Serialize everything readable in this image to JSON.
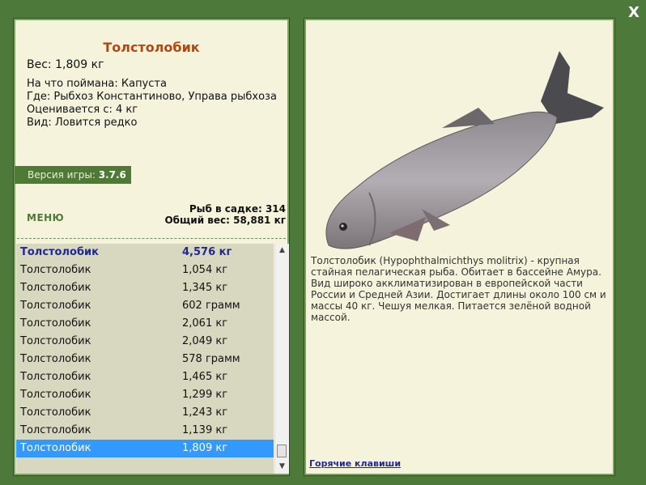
{
  "close_label": "X",
  "fish": {
    "name": "Толстолобик",
    "weight": "Вес: 1,809 кг",
    "caught_with": "На что поймана: Капуста",
    "location": "Где: Рыбхоз Константиново, Управа рыбхоза",
    "valued_from": "Оценивается с: 4 кг",
    "kind": "Вид: Ловится редко"
  },
  "version": {
    "label": "Версия игры:",
    "value": "3.7.6"
  },
  "menu_label": "МЕНЮ",
  "stats": {
    "fish_in_cage": "Рыб в садке: 314",
    "total_weight": "Общий вес: 58,881 кг"
  },
  "catch_list": [
    {
      "name": "Толстолобик",
      "weight": "4,576 кг"
    },
    {
      "name": "Толстолобик",
      "weight": "1,054 кг"
    },
    {
      "name": "Толстолобик",
      "weight": "1,345 кг"
    },
    {
      "name": "Толстолобик",
      "weight": "602 грамм"
    },
    {
      "name": "Толстолобик",
      "weight": "2,061 кг"
    },
    {
      "name": "Толстолобик",
      "weight": "2,049 кг"
    },
    {
      "name": "Толстолобик",
      "weight": "578 грамм"
    },
    {
      "name": "Толстолобик",
      "weight": "1,465 кг"
    },
    {
      "name": "Толстолобик",
      "weight": "1,299 кг"
    },
    {
      "name": "Толстолобик",
      "weight": "1,243 кг"
    },
    {
      "name": "Толстолобик",
      "weight": "1,139 кг"
    },
    {
      "name": "Толстолобик",
      "weight": "1,809 кг"
    }
  ],
  "description": "Толстолобик (Hypophthalmichthys molitrix) - крупная стайная пелагическая рыба. Обитает в бассейне Амура. Вид широко акклиматизирован в европейской части России и Средней Азии. Достигает длины около 100 см и массы 40 кг. Чешуя мелкая. Питается зелёной водной массой.",
  "hotkeys_label": "Горячие клавиши",
  "colors": {
    "frame": "#4d7a3a",
    "panel": "#f5f3dc",
    "title": "#b2480f",
    "link": "#1f2a90",
    "selection": "#3399ff"
  }
}
